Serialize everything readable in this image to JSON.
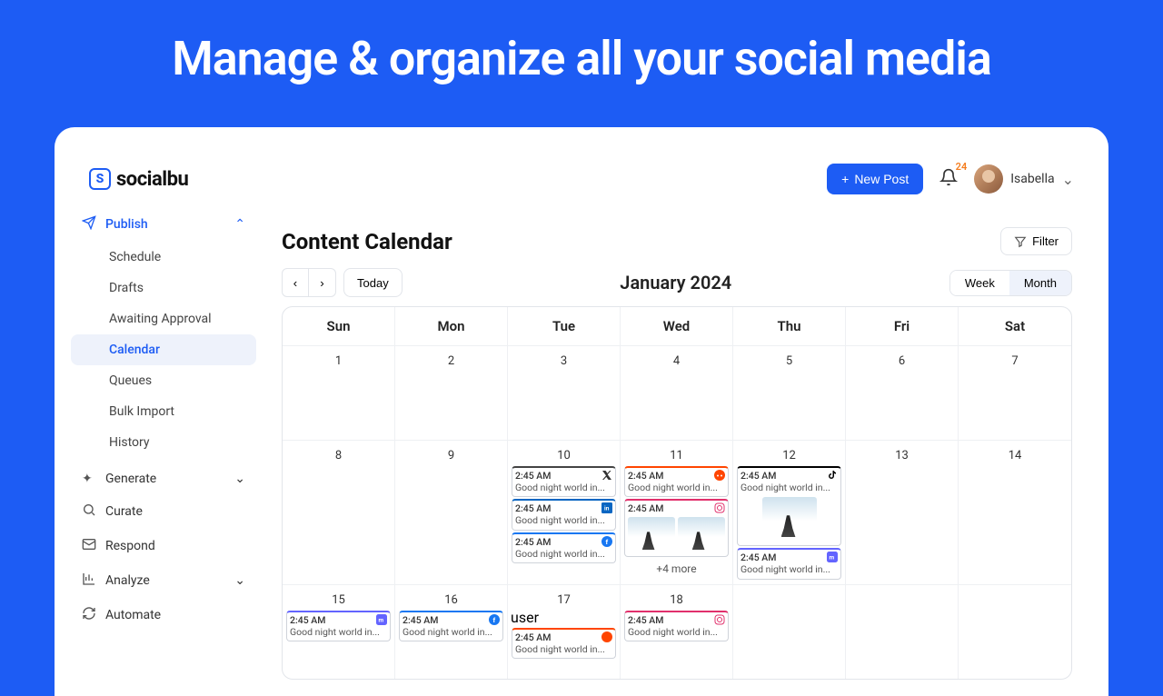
{
  "hero_title": "Manage & organize all your social media",
  "brand": "socialbu",
  "topbar": {
    "new_post": "New Post",
    "notif_count": "24",
    "username": "Isabella"
  },
  "sidebar": {
    "publish": "Publish",
    "schedule": "Schedule",
    "drafts": "Drafts",
    "awaiting": "Awaiting Approval",
    "calendar": "Calendar",
    "queues": "Queues",
    "bulk": "Bulk Import",
    "history": "History",
    "generate": "Generate",
    "curate": "Curate",
    "respond": "Respond",
    "analyze": "Analyze",
    "automate": "Automate"
  },
  "main": {
    "title": "Content Calendar",
    "filter": "Filter",
    "today": "Today",
    "month_label": "January 2024",
    "week": "Week",
    "month": "Month",
    "dow": [
      "Sun",
      "Mon",
      "Tue",
      "Wed",
      "Thu",
      "Fri",
      "Sat"
    ],
    "rows": [
      {
        "days": [
          "1",
          "2",
          "3",
          "4",
          "5",
          "6",
          "7"
        ]
      },
      {
        "days": [
          "8",
          "9",
          "10",
          "11",
          "12",
          "13",
          "14"
        ]
      },
      {
        "days": [
          "15",
          "16",
          "17",
          "18",
          "",
          "",
          ""
        ]
      }
    ],
    "ev_time": "2:45 AM",
    "ev_text": "Good night world in...",
    "more": "+4 more"
  }
}
